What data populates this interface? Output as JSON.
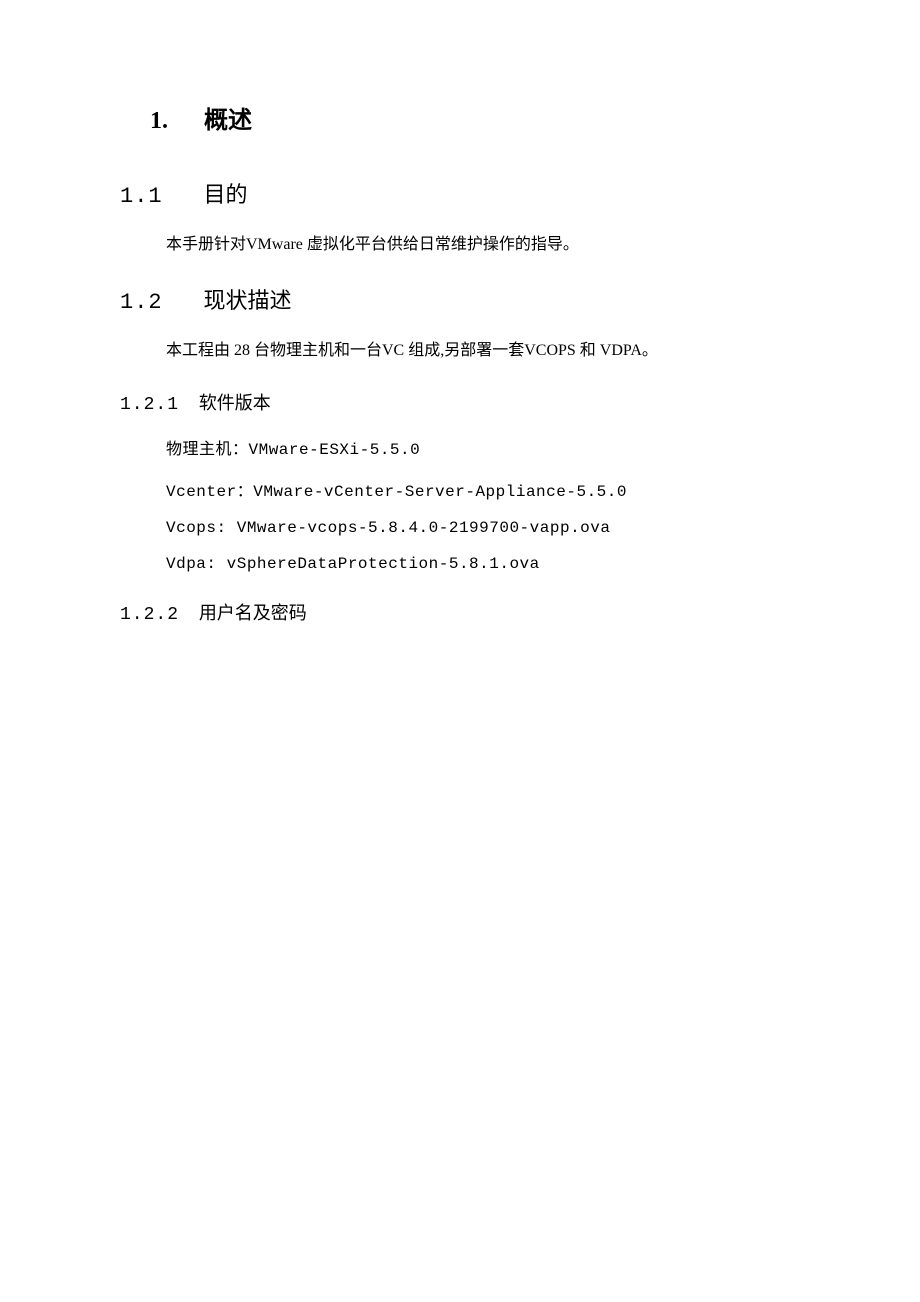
{
  "h1": {
    "num": "1.",
    "title": "概述"
  },
  "s1": {
    "num": "1.1",
    "title": "目的",
    "para": "本手册针对VMware 虚拟化平台供给日常维护操作的指导。"
  },
  "s2": {
    "num": "1.2",
    "title": "现状描述",
    "para": "本工程由 28 台物理主机和一台VC 组成,另部署一套VCOPS 和 VDPA。",
    "sub1": {
      "num": "1.2.1",
      "title": "软件版本",
      "items": [
        "物理主机：VMware-ESXi-5.5.0",
        "Vcenter：VMware-vCenter-Server-Appliance-5.5.0",
        "Vcops: VMware-vcops-5.8.4.0-2199700-vapp.ova",
        "Vdpa: vSphereDataProtection-5.8.1.ova"
      ]
    },
    "sub2": {
      "num": "1.2.2",
      "title": "用户名及密码"
    }
  }
}
